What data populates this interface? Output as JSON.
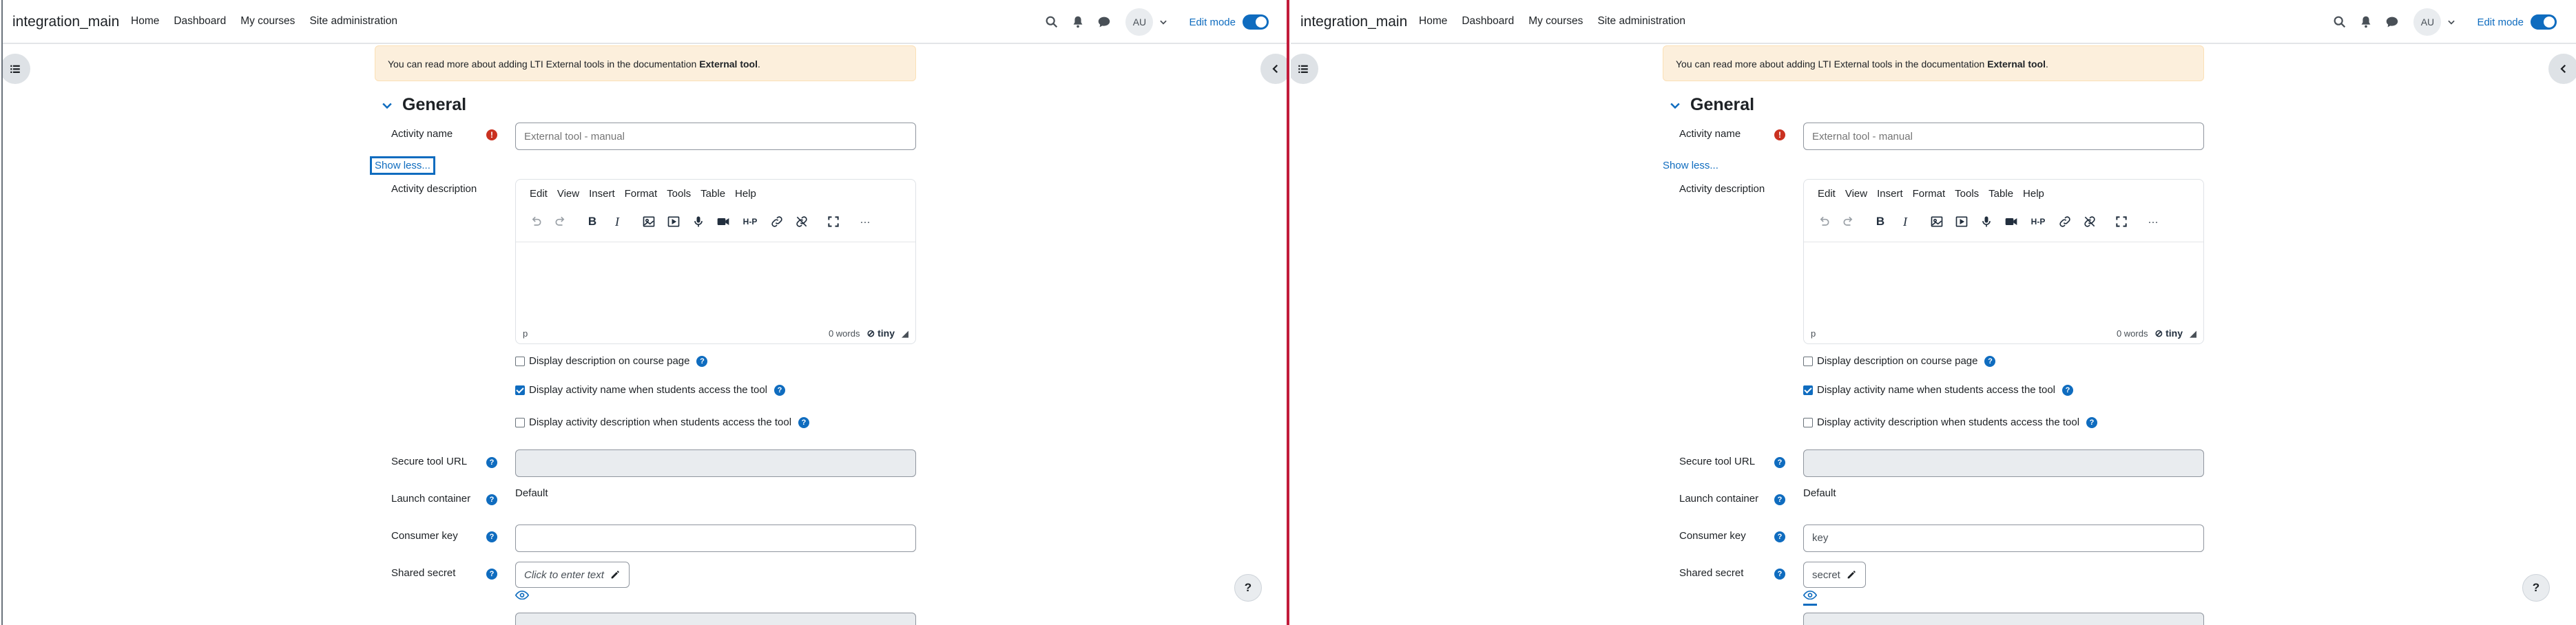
{
  "header": {
    "site_name": "integration_main",
    "nav": [
      "Home",
      "Dashboard",
      "My courses",
      "Site administration"
    ],
    "avatar_initials": "AU",
    "edit_mode_label": "Edit mode"
  },
  "notice": {
    "text": "You can read more about adding LTI External tools in the documentation",
    "link": "External tool",
    "end": "."
  },
  "section": {
    "title": "General"
  },
  "form": {
    "activity_name_label": "Activity name",
    "activity_name_placeholder": "External tool - manual",
    "show_less": "Show less...",
    "activity_description_label": "Activity description",
    "editor": {
      "menu": [
        "Edit",
        "View",
        "Insert",
        "Format",
        "Tools",
        "Table",
        "Help"
      ],
      "h5p": "H-P",
      "more": "···",
      "path": "p",
      "word_count": "0 words",
      "brand": "tiny"
    },
    "checkboxes": [
      {
        "label": "Display description on course page",
        "checked": false
      },
      {
        "label": "Display activity name when students access the tool",
        "checked": true
      },
      {
        "label": "Display activity description when students access the tool",
        "checked": false
      }
    ],
    "secure_url_label": "Secure tool URL",
    "launch_container_label": "Launch container",
    "launch_container_value": "Default",
    "consumer_key_label": "Consumer key",
    "shared_secret_label": "Shared secret"
  },
  "left_pane": {
    "consumer_key_value": "",
    "shared_secret_display": "Click to enter text"
  },
  "right_pane": {
    "consumer_key_value": "key",
    "shared_secret_display": "secret"
  },
  "help_button_label": "?",
  "colors": {
    "accent": "#0f6cbf",
    "required": "#ca3120",
    "notice_bg": "#fcefdc",
    "divider": "#c21b3b"
  }
}
